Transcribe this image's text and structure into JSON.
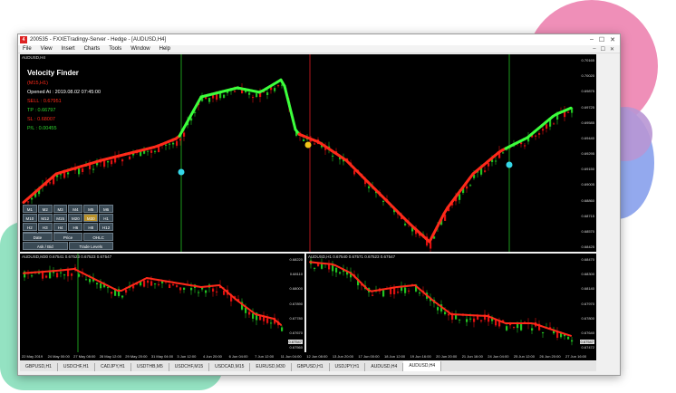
{
  "window": {
    "title": "200535 - FXXETradingy-Server - Hedge - [AUDUSD,H4]",
    "app_icon": "4",
    "controls": [
      "–",
      "☐",
      "✕"
    ]
  },
  "menu": {
    "items": [
      "File",
      "View",
      "Insert",
      "Charts",
      "Tools",
      "Window",
      "Help"
    ],
    "controls": [
      "–",
      "☐",
      "✕"
    ]
  },
  "main_chart": {
    "symbol_label": "AUDUSD,H4",
    "info": {
      "title": "Velocity Finder",
      "subtitle": "(M15,H1)",
      "opened_at": "Opened At : 2019.08.02 07:45:00",
      "sell": "SELL : 0.67951",
      "tp": "TP : 0.66797",
      "sl": "SL : 0.68007",
      "pl": "P/L : 0.00455"
    },
    "price_ticks": [
      "0.70165",
      "0.70020",
      "0.69875",
      "0.69725",
      "0.69585",
      "0.69440",
      "0.69295",
      "0.69150",
      "0.69005",
      "0.68860",
      "0.68715",
      "0.68570",
      "0.68425"
    ],
    "timeframes": [
      "M1",
      "M2",
      "M3",
      "M4",
      "M5",
      "M6",
      "M10",
      "M12",
      "M15",
      "M20",
      "M30",
      "H1",
      "H2",
      "H3",
      "H4",
      "H6",
      "H8",
      "H12",
      "D1",
      "W1",
      "MN"
    ],
    "selected_timeframe": "M30",
    "options_row1": [
      "Date",
      "Price",
      "OHLC"
    ],
    "options_row2": [
      "Ask / Bid",
      "Trade Levels"
    ]
  },
  "left_chart": {
    "symbol_label": "AUDUSD,M30  0.67541 0.67523 0.67523 0.67547",
    "price_ticks": [
      "0.68220",
      "0.68110",
      "0.68000",
      "0.67890",
      "0.67780",
      "0.67670",
      "0.67560"
    ],
    "current_price": "0.67547"
  },
  "right_chart": {
    "symbol_label": "AUDUSD,H1  0.67540 0.67571 0.67523 0.67547",
    "price_ticks": [
      "0.68470",
      "0.68300",
      "0.68140",
      "0.67970",
      "0.67800",
      "0.67640",
      "0.67472"
    ],
    "current_price": "0.67547"
  },
  "time_axis": [
    "22 May 2019",
    "24 May 00:00",
    "27 May 08:00",
    "28 May 12:00",
    "29 May 20:00",
    "31 May 04:00",
    "3 Jun 12:00",
    "4 Jun 20:00",
    "6 Jun 04:00",
    "7 Jun 12:00",
    "11 Jun 04:00",
    "12 Jun 08:00",
    "13 Jun 20:00",
    "17 Jun 00:00",
    "18 Jun 12:00",
    "19 Jun 16:00",
    "20 Jun 20:00",
    "21 Jun 16:00",
    "24 Jun 04:00",
    "25 Jun 12:00",
    "26 Jun 20:00",
    "27 Jun 16:00"
  ],
  "tabs": [
    "GBPUSD,H1",
    "USDCHF,H1",
    "CADJPY,H1",
    "USDTHB,M5",
    "USDCHF,M15",
    "USDCAD,M15",
    "EURUSD,M30",
    "GBPUSD,H1",
    "USDJPY,H1",
    "AUDUSD,H4",
    "AUDUSD,H4"
  ],
  "active_tab_index": 10,
  "colors": {
    "bull_candle": "#21c321",
    "bear_candle": "#e01010",
    "trend_up": "#3cff3c",
    "trend_down": "#ff2a1a",
    "vline_green": "#1b9a1b",
    "vline_red": "#b3161d",
    "marker_yellow": "#f0c419",
    "marker_cyan": "#35d7e8"
  }
}
